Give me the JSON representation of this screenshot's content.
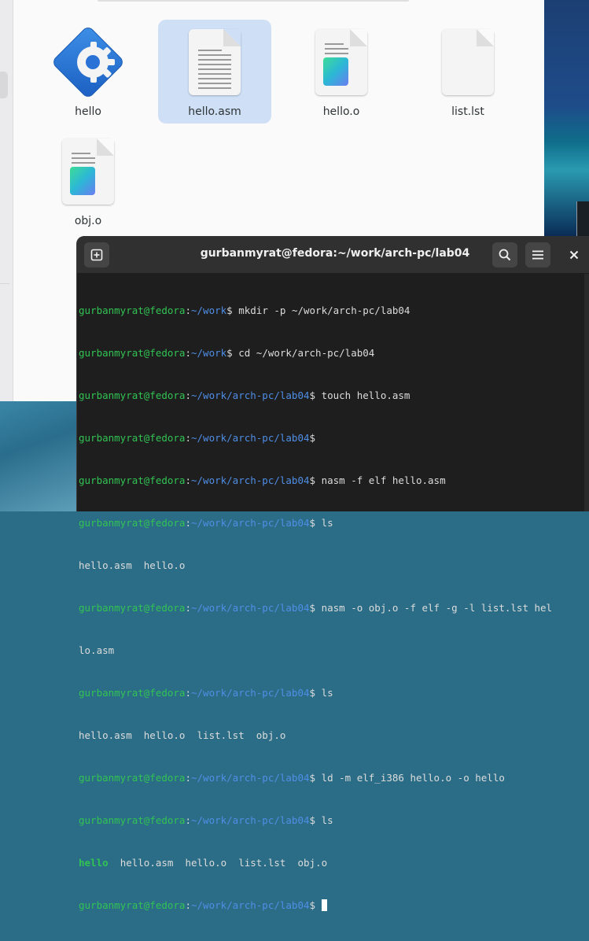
{
  "files": {
    "items": [
      {
        "name": "hello",
        "icon": "executable-gear-icon"
      },
      {
        "name": "hello.asm",
        "icon": "text-document-icon"
      },
      {
        "name": "hello.o",
        "icon": "object-file-icon"
      },
      {
        "name": "list.lst",
        "icon": "blank-document-icon"
      },
      {
        "name": "obj.o",
        "icon": "object-file-icon"
      }
    ],
    "selected": "hello.asm"
  },
  "terminal": {
    "title": "gurbanmyrat@fedora:~/work/arch-pc/lab04",
    "user_host": "gurbanmyrat@fedora",
    "lines": [
      {
        "path": "~/work",
        "cmd": " mkdir -p ~/work/arch-pc/lab04"
      },
      {
        "path": "~/work",
        "cmd": " cd ~/work/arch-pc/lab04"
      },
      {
        "path": "~/work/arch-pc/lab04",
        "cmd": " touch hello.asm"
      },
      {
        "path": "~/work/arch-pc/lab04",
        "cmd": ""
      },
      {
        "path": "~/work/arch-pc/lab04",
        "cmd": " nasm -f elf hello.asm"
      },
      {
        "path": "~/work/arch-pc/lab04",
        "cmd": " ls"
      },
      {
        "output": "hello.asm  hello.o"
      },
      {
        "path": "~/work/arch-pc/lab04",
        "cmd": " nasm -o obj.o -f elf -g -l list.lst hel"
      },
      {
        "output": "lo.asm"
      },
      {
        "path": "~/work/arch-pc/lab04",
        "cmd": " ls"
      },
      {
        "output": "hello.asm  hello.o  list.lst  obj.o"
      },
      {
        "path": "~/work/arch-pc/lab04",
        "cmd": " ld -m elf_i386 hello.o -o hello"
      },
      {
        "path": "~/work/arch-pc/lab04",
        "cmd": " ls"
      },
      {
        "exec": "hello",
        "output": "  hello.asm  hello.o  list.lst  obj.o"
      },
      {
        "path": "~/work/arch-pc/lab04",
        "cmd": " ",
        "cursor": true
      }
    ],
    "colors": {
      "user": "#32c353",
      "path": "#4f8ee6",
      "text": "#dcdcdc",
      "background": "#1e1e1e"
    }
  }
}
